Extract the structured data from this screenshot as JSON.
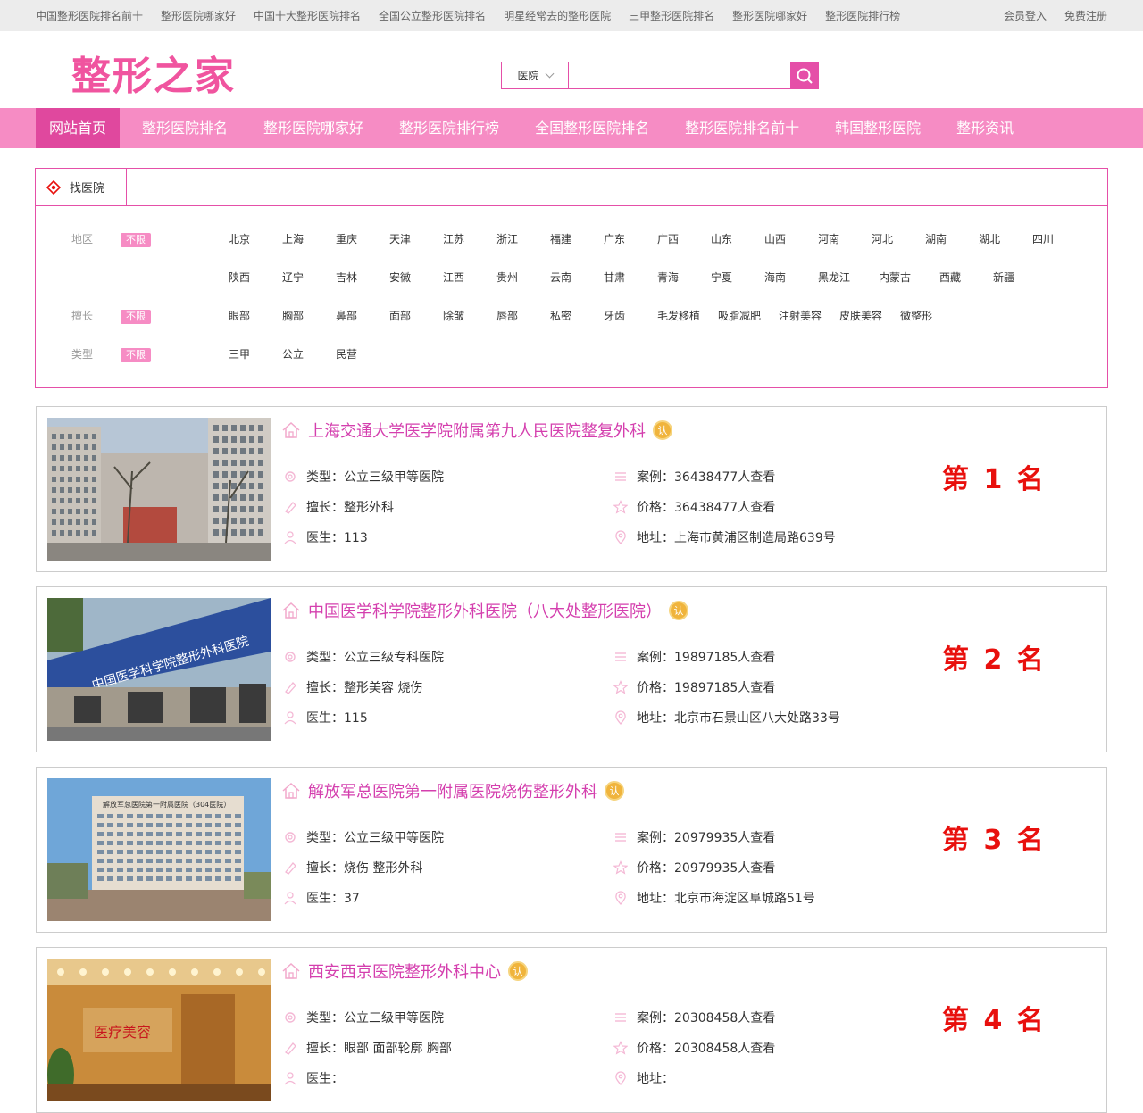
{
  "topbar": {
    "links": [
      "中国整形医院排名前十",
      "整形医院哪家好",
      "中国十大整形医院排名",
      "全国公立整形医院排名",
      "明星经常去的整形医院",
      "三甲整形医院排名",
      "整形医院哪家好",
      "整形医院排行榜"
    ],
    "login": "会员登入",
    "register": "免费注册"
  },
  "logo": "整形之家",
  "search": {
    "select": "医院",
    "value": ""
  },
  "nav": [
    "网站首页",
    "整形医院排名",
    "整形医院哪家好",
    "整形医院排行榜",
    "全国整形医院排名",
    "整形医院排名前十",
    "韩国整形医院",
    "整形资讯"
  ],
  "filter": {
    "tab": "找医院",
    "all": "不限",
    "area_label": "地区",
    "areas": [
      "北京",
      "上海",
      "重庆",
      "天津",
      "江苏",
      "浙江",
      "福建",
      "广东",
      "广西",
      "山东",
      "山西",
      "河南",
      "河北",
      "湖南",
      "湖北",
      "四川",
      "陕西",
      "辽宁",
      "吉林",
      "安徽",
      "江西",
      "贵州",
      "云南",
      "甘肃",
      "青海",
      "宁夏",
      "海南",
      "黑龙江",
      "内蒙古",
      "西藏",
      "新疆"
    ],
    "spec_label": "擅长",
    "specs": [
      "眼部",
      "胸部",
      "鼻部",
      "面部",
      "除皱",
      "唇部",
      "私密",
      "牙齿",
      "毛发移植",
      "吸脂减肥",
      "注射美容",
      "皮肤美容",
      "微整形"
    ],
    "type_label": "类型",
    "types": [
      "三甲",
      "公立",
      "民营"
    ]
  },
  "hospitals": [
    {
      "name": "上海交通大学医学院附属第九人民医院整复外科",
      "badge": "认",
      "type": "类型：公立三级甲等医院",
      "spec": "擅长：整形外科",
      "doctors": "医生：113",
      "cases": "案例：36438477人查看",
      "price": "价格：36438477人查看",
      "addr": "地址：上海市黄浦区制造局路639号",
      "rank": "第 1 名"
    },
    {
      "name": "中国医学科学院整形外科医院（八大处整形医院）",
      "badge": "认",
      "type": "类型：公立三级专科医院",
      "spec": "擅长：整形美容 烧伤",
      "doctors": "医生：115",
      "cases": "案例：19897185人查看",
      "price": "价格：19897185人查看",
      "addr": "地址：北京市石景山区八大处路33号",
      "rank": "第 2 名"
    },
    {
      "name": "解放军总医院第一附属医院烧伤整形外科",
      "badge": "认",
      "type": "类型：公立三级甲等医院",
      "spec": "擅长：烧伤 整形外科",
      "doctors": "医生：37",
      "cases": "案例：20979935人查看",
      "price": "价格：20979935人查看",
      "addr": "地址：北京市海淀区阜城路51号",
      "rank": "第 3 名"
    },
    {
      "name": "西安西京医院整形外科中心",
      "badge": "认",
      "type": "类型：公立三级甲等医院",
      "spec": "擅长：眼部 面部轮廓 胸部",
      "doctors": "医生：",
      "cases": "案例：20308458人查看",
      "price": "价格：20308458人查看",
      "addr": "地址：",
      "rank": "第 4 名"
    }
  ],
  "photo_texts": [
    "解放军总医院第一附属医院（304医院）",
    "医疗美容"
  ],
  "colors": {
    "pink": "#f68cc4",
    "accent": "#e54fa8",
    "title": "#d43fae",
    "rank": "#e8100d",
    "logo": "#f0549f"
  }
}
